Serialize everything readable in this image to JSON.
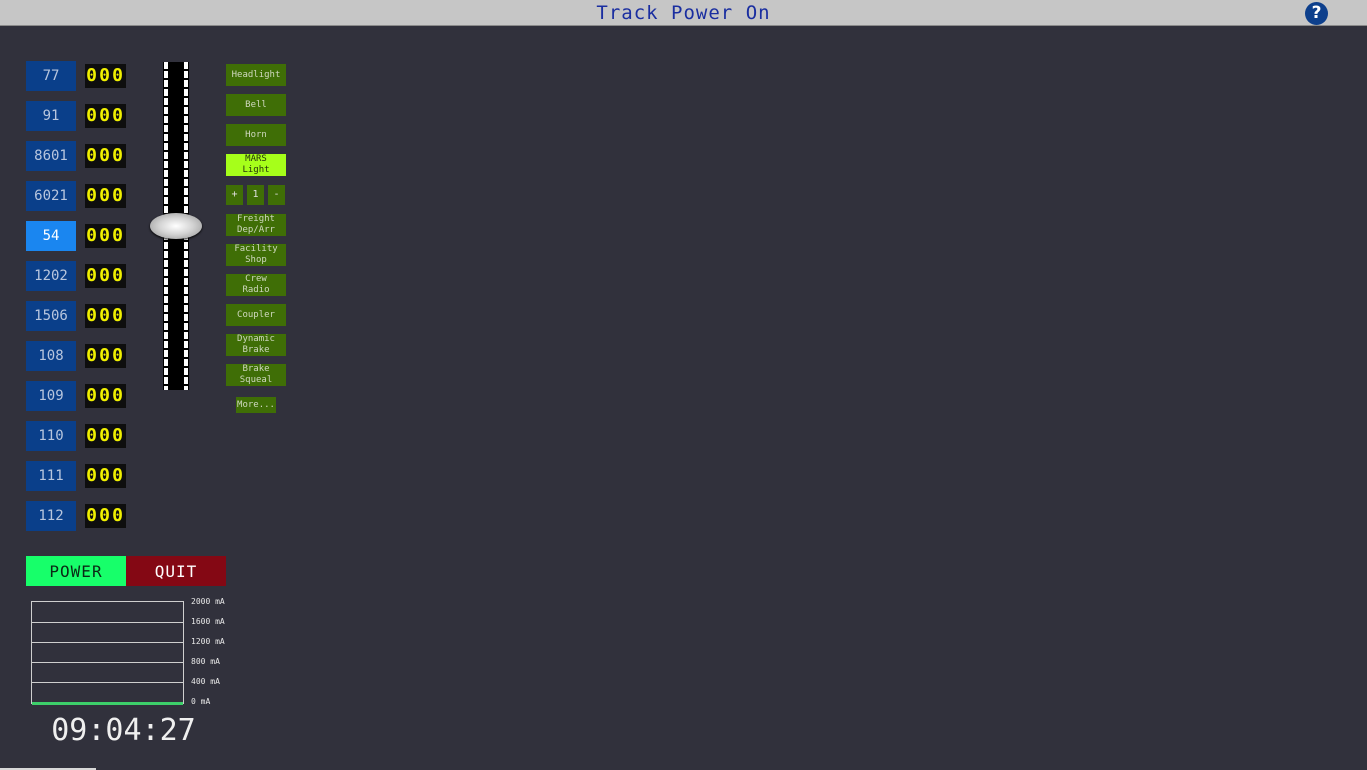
{
  "header": {
    "title": "Track Power On",
    "help_label": "?"
  },
  "locos": [
    {
      "id": "77",
      "speed": [
        "0",
        "0",
        "0"
      ],
      "active": false
    },
    {
      "id": "91",
      "speed": [
        "0",
        "0",
        "0"
      ],
      "active": false
    },
    {
      "id": "8601",
      "speed": [
        "0",
        "0",
        "0"
      ],
      "active": false
    },
    {
      "id": "6021",
      "speed": [
        "0",
        "0",
        "0"
      ],
      "active": false
    },
    {
      "id": "54",
      "speed": [
        "0",
        "0",
        "0"
      ],
      "active": true
    },
    {
      "id": "1202",
      "speed": [
        "0",
        "0",
        "0"
      ],
      "active": false
    },
    {
      "id": "1506",
      "speed": [
        "0",
        "0",
        "0"
      ],
      "active": false
    },
    {
      "id": "108",
      "speed": [
        "0",
        "0",
        "0"
      ],
      "active": false
    },
    {
      "id": "109",
      "speed": [
        "0",
        "0",
        "0"
      ],
      "active": false
    },
    {
      "id": "110",
      "speed": [
        "0",
        "0",
        "0"
      ],
      "active": false
    },
    {
      "id": "111",
      "speed": [
        "0",
        "0",
        "0"
      ],
      "active": false
    },
    {
      "id": "112",
      "speed": [
        "0",
        "0",
        "0"
      ],
      "active": false
    }
  ],
  "throttle": {
    "level": 0.5
  },
  "functions": [
    {
      "label": "Headlight",
      "on": false
    },
    {
      "label": "Bell",
      "on": false
    },
    {
      "label": "Horn",
      "on": false
    },
    {
      "label": "MARS\nLight",
      "on": true
    },
    {
      "label": "Freight\nDep/Arr",
      "on": false
    },
    {
      "label": "Facility\nShop",
      "on": false
    },
    {
      "label": "Crew\nRadio",
      "on": false
    },
    {
      "label": "Coupler",
      "on": false
    },
    {
      "label": "Dynamic\nBrake",
      "on": false
    },
    {
      "label": "Brake\nSqueal",
      "on": false
    }
  ],
  "stepper": {
    "plus": "+",
    "value": "1",
    "minus": "-"
  },
  "more_label": "More...",
  "controls": {
    "power_label": "POWER",
    "quit_label": "QUIT"
  },
  "current_meter": {
    "labels": [
      "2000 mA",
      "1600 mA",
      "1200 mA",
      "800 mA",
      "400 mA",
      "0 mA"
    ],
    "value_mA": 0
  },
  "clock": "09:04:27"
}
